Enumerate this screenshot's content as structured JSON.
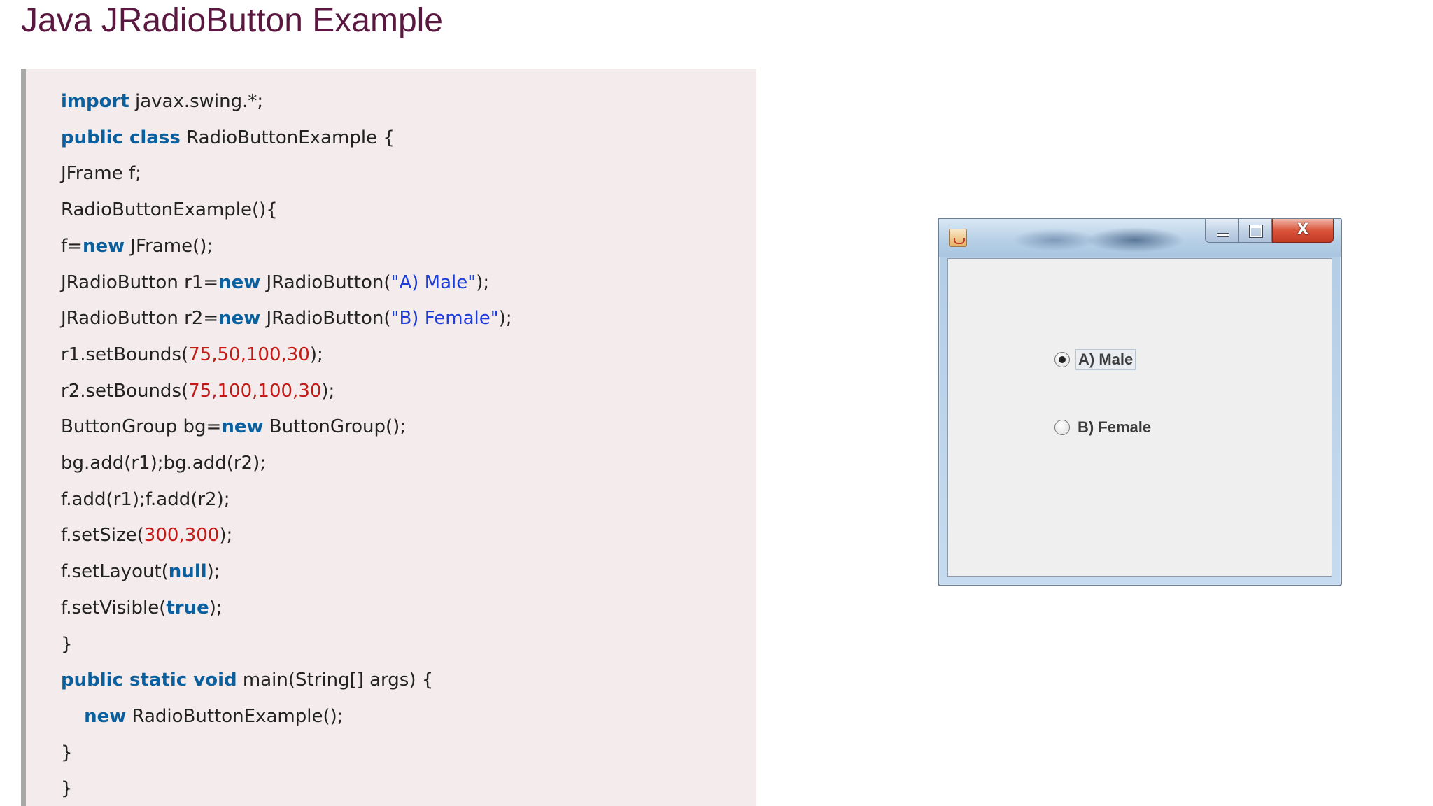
{
  "page": {
    "title": "Java JRadioButton Example"
  },
  "code": {
    "lines": [
      [
        {
          "t": "import",
          "c": "kw"
        },
        {
          "t": " javax.swing.*;"
        }
      ],
      [
        {
          "t": "public class",
          "c": "kw"
        },
        {
          "t": " RadioButtonExample {"
        }
      ],
      [
        {
          "t": "JFrame f;"
        }
      ],
      [
        {
          "t": "RadioButtonExample(){"
        }
      ],
      [
        {
          "t": "f="
        },
        {
          "t": "new",
          "c": "kw"
        },
        {
          "t": " JFrame();"
        }
      ],
      [
        {
          "t": "JRadioButton r1="
        },
        {
          "t": "new",
          "c": "kw"
        },
        {
          "t": " JRadioButton("
        },
        {
          "t": "\"A) Male\"",
          "c": "str"
        },
        {
          "t": ");"
        }
      ],
      [
        {
          "t": "JRadioButton r2="
        },
        {
          "t": "new",
          "c": "kw"
        },
        {
          "t": " JRadioButton("
        },
        {
          "t": "\"B) Female\"",
          "c": "str"
        },
        {
          "t": ");"
        }
      ],
      [
        {
          "t": "r1.setBounds("
        },
        {
          "t": "75",
          "c": "num"
        },
        {
          "t": ",",
          "c": "num"
        },
        {
          "t": "50",
          "c": "num"
        },
        {
          "t": ",",
          "c": "num"
        },
        {
          "t": "100",
          "c": "num"
        },
        {
          "t": ",",
          "c": "num"
        },
        {
          "t": "30",
          "c": "num"
        },
        {
          "t": ");"
        }
      ],
      [
        {
          "t": "r2.setBounds("
        },
        {
          "t": "75",
          "c": "num"
        },
        {
          "t": ",",
          "c": "num"
        },
        {
          "t": "100",
          "c": "num"
        },
        {
          "t": ",",
          "c": "num"
        },
        {
          "t": "100",
          "c": "num"
        },
        {
          "t": ",",
          "c": "num"
        },
        {
          "t": "30",
          "c": "num"
        },
        {
          "t": ");"
        }
      ],
      [
        {
          "t": "ButtonGroup bg="
        },
        {
          "t": "new",
          "c": "kw"
        },
        {
          "t": " ButtonGroup();"
        }
      ],
      [
        {
          "t": "bg.add(r1);bg.add(r2);"
        }
      ],
      [
        {
          "t": "f.add(r1);f.add(r2);"
        }
      ],
      [
        {
          "t": "f.setSize("
        },
        {
          "t": "300",
          "c": "num"
        },
        {
          "t": ",",
          "c": "num"
        },
        {
          "t": "300",
          "c": "num"
        },
        {
          "t": ");"
        }
      ],
      [
        {
          "t": "f.setLayout("
        },
        {
          "t": "null",
          "c": "kw"
        },
        {
          "t": ");"
        }
      ],
      [
        {
          "t": "f.setVisible("
        },
        {
          "t": "true",
          "c": "kw"
        },
        {
          "t": ");"
        }
      ],
      [
        {
          "t": "}"
        }
      ],
      [
        {
          "t": "public static void",
          "c": "kw"
        },
        {
          "t": " main(String[] args) {"
        }
      ],
      [
        {
          "t": "    "
        },
        {
          "t": "new",
          "c": "kw"
        },
        {
          "t": " RadioButtonExample();"
        }
      ],
      [
        {
          "t": "}"
        }
      ],
      [
        {
          "t": "}"
        }
      ]
    ]
  },
  "window": {
    "close_glyph": "X",
    "radios": [
      {
        "label": "A) Male",
        "checked": true
      },
      {
        "label": "B) Female",
        "checked": false
      }
    ]
  },
  "colors": {
    "keyword": "#0a5f9e",
    "string": "#1d3ddb",
    "number": "#c41a16",
    "title": "#5a1840",
    "code_background": "#f4ecec"
  },
  "icons": {
    "window_icon": "java-icon",
    "minimize": "minimize-icon",
    "maximize": "maximize-icon",
    "close": "close-icon"
  }
}
